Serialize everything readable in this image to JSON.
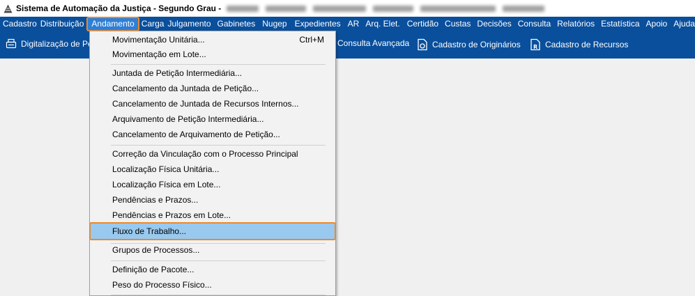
{
  "window": {
    "title": "Sistema de Automação da Justiça - Segundo Grau -"
  },
  "menubar": {
    "items": [
      {
        "label": "Cadastro",
        "name": "menu-cadastro"
      },
      {
        "label": "Distribuição",
        "name": "menu-distribuicao"
      },
      {
        "label": "Andamento",
        "name": "menu-andamento"
      },
      {
        "label": "Carga",
        "name": "menu-carga"
      },
      {
        "label": "Julgamento",
        "name": "menu-julgamento"
      },
      {
        "label": "Gabinetes",
        "name": "menu-gabinetes"
      },
      {
        "label": "Nugep",
        "name": "menu-nugep"
      },
      {
        "label": "Expedientes",
        "name": "menu-expedientes"
      },
      {
        "label": "AR",
        "name": "menu-ar"
      },
      {
        "label": "Arq. Elet.",
        "name": "menu-arq-elet"
      },
      {
        "label": "Certidão",
        "name": "menu-certidao"
      },
      {
        "label": "Custas",
        "name": "menu-custas"
      },
      {
        "label": "Decisões",
        "name": "menu-decisoes"
      },
      {
        "label": "Consulta",
        "name": "menu-consulta"
      },
      {
        "label": "Relatórios",
        "name": "menu-relatorios"
      },
      {
        "label": "Estatística",
        "name": "menu-estatistica"
      },
      {
        "label": "Apoio",
        "name": "menu-apoio"
      },
      {
        "label": "Ajuda",
        "name": "menu-ajuda"
      }
    ]
  },
  "toolbar": {
    "digitalizacao": "Digitalização de Pe",
    "consulta_avancada": "Consulta Avançada",
    "cadastro_originarios": "Cadastro de Originários",
    "cadastro_recursos": "Cadastro de Recursos"
  },
  "dropdown": {
    "items": [
      {
        "label": "Movimentação Unitária...",
        "shortcut": "Ctrl+M"
      },
      {
        "label": "Movimentação em Lote...",
        "shortcut": ""
      },
      {
        "label": "Juntada de Petição Intermediária...",
        "shortcut": ""
      },
      {
        "label": "Cancelamento da Juntada de Petição...",
        "shortcut": ""
      },
      {
        "label": "Cancelamento de Juntada de Recursos Internos...",
        "shortcut": ""
      },
      {
        "label": "Arquivamento de Petição Intermediária...",
        "shortcut": ""
      },
      {
        "label": "Cancelamento de Arquivamento de Petição...",
        "shortcut": ""
      },
      {
        "label": "Correção da Vinculação com o Processo Principal",
        "shortcut": ""
      },
      {
        "label": "Localização Física Unitária...",
        "shortcut": ""
      },
      {
        "label": "Localização Física em Lote...",
        "shortcut": ""
      },
      {
        "label": "Pendências e Prazos...",
        "shortcut": ""
      },
      {
        "label": "Pendências e Prazos em Lote...",
        "shortcut": ""
      },
      {
        "label": "Fluxo de Trabalho...",
        "shortcut": ""
      },
      {
        "label": "Grupos de Processos...",
        "shortcut": ""
      },
      {
        "label": "Definição de Pacote...",
        "shortcut": ""
      },
      {
        "label": "Peso do Processo Físico...",
        "shortcut": ""
      }
    ]
  },
  "colors": {
    "menubar_bg": "#0a4f9c",
    "highlight_border": "#e88a2e",
    "selected_item_bg": "#99c9ef"
  }
}
